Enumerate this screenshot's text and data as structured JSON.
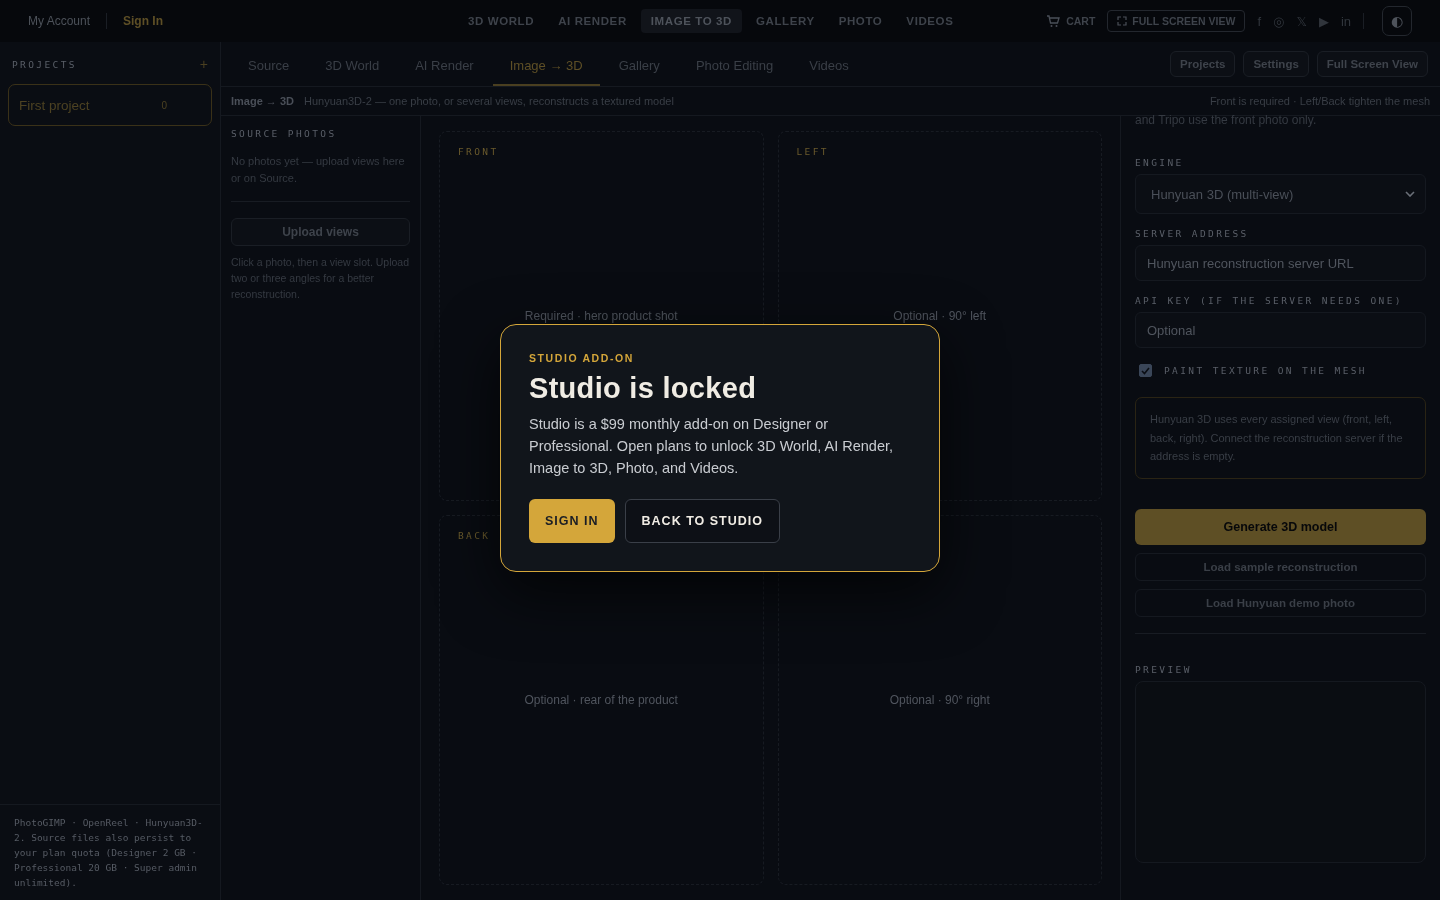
{
  "topbar": {
    "account": "My Account",
    "sign_in": "Sign In",
    "nav": [
      {
        "label": "3D WORLD",
        "selected": false
      },
      {
        "label": "AI RENDER",
        "selected": false
      },
      {
        "label": "IMAGE TO 3D",
        "selected": true
      },
      {
        "label": "GALLERY",
        "selected": false
      },
      {
        "label": "PHOTO",
        "selected": false
      },
      {
        "label": "VIDEOS",
        "selected": false
      }
    ],
    "cart": "CART",
    "fullscreen": "FULL SCREEN VIEW",
    "social": [
      "f",
      "◎",
      "𝕏",
      "▶",
      "in"
    ],
    "theme_toggle": "◐"
  },
  "sidebar": {
    "title": "PROJECTS",
    "add": "+",
    "projects": [
      {
        "name": "First project",
        "count": "0",
        "selected": true
      }
    ],
    "footer": "PhotoGIMP · OpenReel · Hunyuan3D-2. Source files also persist to your plan quota (Designer 2 GB · Professional 20 GB · Super admin unlimited)."
  },
  "tabs": [
    {
      "label": "Source",
      "selected": false
    },
    {
      "label": "3D World",
      "selected": false
    },
    {
      "label": "AI Render",
      "selected": false
    },
    {
      "label": "Image → 3D",
      "selected": true
    },
    {
      "label": "Gallery",
      "selected": false
    },
    {
      "label": "Photo Editing",
      "selected": false
    },
    {
      "label": "Videos",
      "selected": false
    }
  ],
  "tab_buttons": [
    "Projects",
    "Settings",
    "Full Screen View"
  ],
  "breadcrumb": {
    "title": "Image → 3D",
    "subtitle": "Hunyuan3D-2 — one photo, or several views, reconstructs a textured model",
    "note": "Front is required · Left/Back tighten the mesh"
  },
  "source": {
    "title": "SOURCE PHOTOS",
    "empty": "No photos yet — upload views here or on Source.",
    "upload": "Upload views",
    "hint": "Click a photo, then a view slot. Upload two or three angles for a better reconstruction."
  },
  "views": [
    {
      "label": "FRONT",
      "hint": "Required · hero product shot"
    },
    {
      "label": "LEFT",
      "hint": "Optional · 90° left"
    },
    {
      "label": "BACK",
      "hint": "Optional · rear of the product"
    },
    {
      "hint": "Optional · 90° right"
    }
  ],
  "settings": {
    "cut_text": "and Tripo use the front photo only.",
    "engine_label": "ENGINE",
    "engine": "Hunyuan 3D (multi-view)",
    "server_label": "SERVER ADDRESS",
    "server_placeholder": "Hunyuan reconstruction server URL",
    "key_label": "API KEY (IF THE SERVER NEEDS ONE)",
    "key_placeholder": "Optional",
    "texture": {
      "label": "PAINT TEXTURE ON THE MESH",
      "checked": true
    },
    "info": "Hunyuan 3D uses every assigned view (front, left, back, right). Connect the reconstruction server if the address is empty.",
    "generate": "Generate 3D model",
    "sample": "Load sample reconstruction",
    "demo": "Load Hunyuan demo photo",
    "preview_label": "PREVIEW"
  },
  "modal": {
    "eyebrow": "STUDIO ADD-ON",
    "title": "Studio is locked",
    "body": "Studio is a $99 monthly add-on on Designer or Professional. Open plans to unlock 3D World, AI Render, Image to 3D, Photo, and Videos.",
    "primary": "SIGN IN",
    "secondary": "BACK TO STUDIO"
  }
}
